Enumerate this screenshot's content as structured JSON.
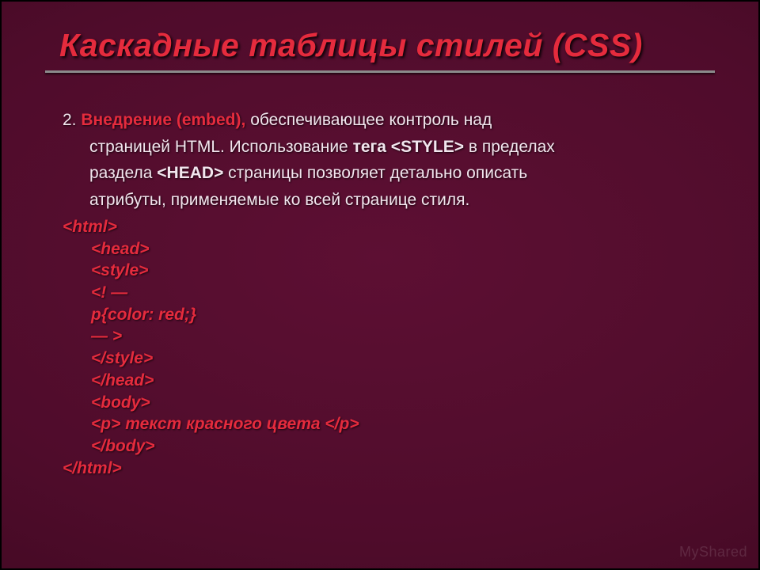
{
  "title": "Каскадные таблицы стилей (CSS)",
  "para": {
    "num": "2. ",
    "lead": "Внедрение (embed), ",
    "t1": "обеспечивающее контроль над",
    "l2a": "страницей HTML. Использование ",
    "l2tag": "тега <STYLE>",
    "l2b": " в пределах",
    "l3a": "раздела ",
    "l3tag": "<HEAD>",
    "l3b": " страницы позволяет детально описать",
    "l4": "атрибуты, применяемые ко всей странице стиля."
  },
  "code": {
    "c0": "<html>",
    "c1": "<head>",
    "c2": "<style>",
    "c3": "<! —",
    "c4": "p{color: red;}",
    "c5": "— >",
    "c6": "</style>",
    "c7": "</head>",
    "c8": "<body>",
    "c9a": "<p> ",
    "c9b": "текст красного цвета",
    "c9c": " </p>",
    "c10": "</body>",
    "c11": "</html>"
  },
  "watermark": "MyShared"
}
